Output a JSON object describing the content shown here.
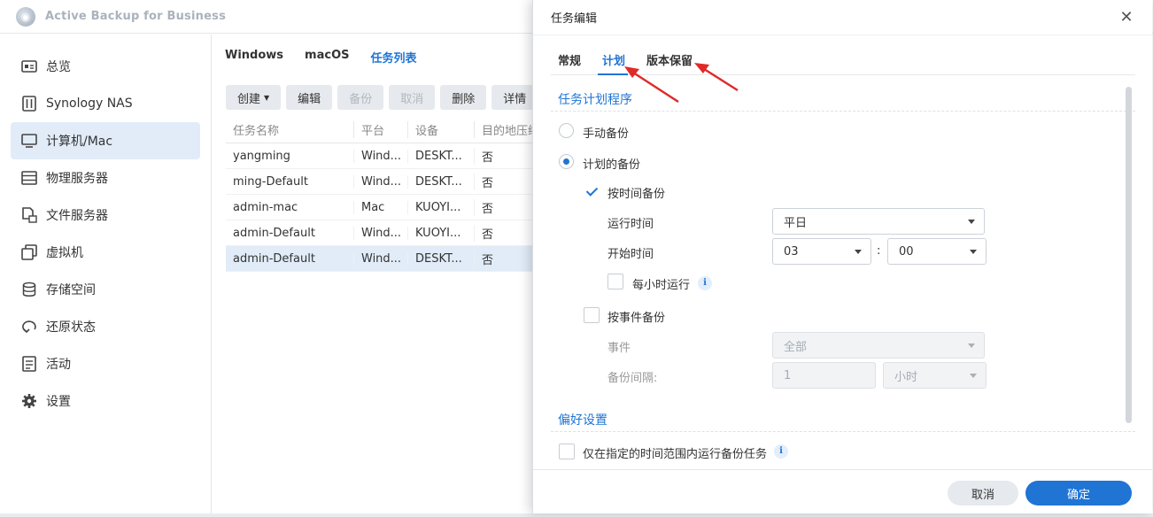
{
  "app": {
    "title": "Active Backup for Business"
  },
  "sidebar": {
    "items": [
      {
        "label": "总览",
        "icon": "overview-icon"
      },
      {
        "label": "Synology NAS",
        "icon": "nas-icon"
      },
      {
        "label": "计算机/Mac",
        "icon": "computer-icon",
        "active": true
      },
      {
        "label": "物理服务器",
        "icon": "server-icon"
      },
      {
        "label": "文件服务器",
        "icon": "file-server-icon"
      },
      {
        "label": "虚拟机",
        "icon": "vm-icon"
      },
      {
        "label": "存储空间",
        "icon": "storage-icon"
      },
      {
        "label": "还原状态",
        "icon": "restore-icon"
      },
      {
        "label": "活动",
        "icon": "activity-icon"
      },
      {
        "label": "设置",
        "icon": "gear-icon"
      }
    ]
  },
  "main": {
    "tabs": [
      "Windows",
      "macOS",
      "任务列表"
    ],
    "toolbar": {
      "create": "创建",
      "edit": "编辑",
      "backup": "备份",
      "cancel": "取消",
      "delete": "删除",
      "details": "详情"
    },
    "table": {
      "headers": [
        "任务名称",
        "平台",
        "设备",
        "目的地压缩"
      ],
      "rows": [
        [
          "yangming",
          "Wind...",
          "DESKT...",
          "否"
        ],
        [
          "ming-Default",
          "Wind...",
          "DESKT...",
          "否"
        ],
        [
          "admin-mac",
          "Mac",
          "KUOYI...",
          "否"
        ],
        [
          "admin-Default",
          "Wind...",
          "KUOYI...",
          "否"
        ],
        [
          "admin-Default",
          "Wind...",
          "DESKT...",
          "否"
        ]
      ]
    }
  },
  "dialog": {
    "title": "任务编辑",
    "tabs": [
      "常规",
      "计划",
      "版本保留"
    ],
    "schedule": {
      "section_title": "任务计划程序",
      "manual_backup": "手动备份",
      "scheduled_backup": "计划的备份",
      "by_time": "按时间备份",
      "run_time_label": "运行时间",
      "run_time_value": "平日",
      "start_time_label": "开始时间",
      "start_hour": "03",
      "time_sep": ":",
      "start_minute": "00",
      "hourly": "每小时运行",
      "by_event": "按事件备份",
      "event_label": "事件",
      "event_value": "全部",
      "interval_label": "备份间隔:",
      "interval_value": "1",
      "interval_unit": "小时"
    },
    "preferences": {
      "section_title": "偏好设置",
      "window_only": "仅在指定的时间范围内运行备份任务"
    },
    "buttons": {
      "cancel": "取消",
      "ok": "确定"
    },
    "info_glyph": "i",
    "close_glyph": "✕"
  }
}
